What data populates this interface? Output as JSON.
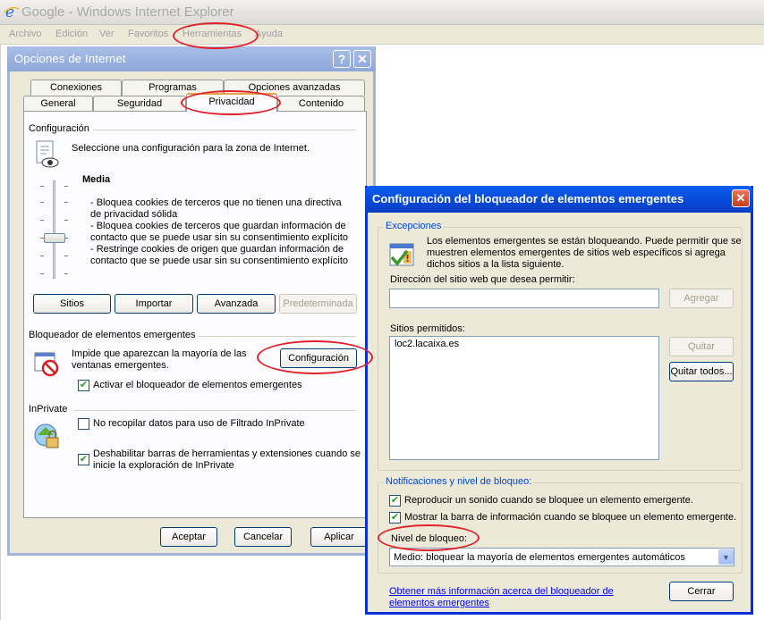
{
  "ie_window": {
    "title": "Google - Windows Internet Explorer",
    "menu": [
      "Archivo",
      "Edición",
      "Ver",
      "Favoritos",
      "Herramientas",
      "Ayuda"
    ]
  },
  "internet_options": {
    "title": "Opciones de Internet",
    "help_glyph": "?",
    "close_glyph": "✕",
    "tabs_back": [
      "Conexiones",
      "Programas",
      "Opciones avanzadas"
    ],
    "tabs_front": [
      "General",
      "Seguridad",
      "Privacidad",
      "Contenido"
    ],
    "active_tab": "Privacidad",
    "config_group": "Configuración",
    "zone_text": "Seleccione una configuración para la zona de Internet.",
    "level_name": "Media",
    "level_description": [
      "- Bloquea cookies de terceros que no tienen una directiva",
      "de privacidad sólida",
      "- Bloquea cookies de terceros que guardan información de",
      "contacto que se puede usar sin su consentimiento explícito",
      "- Restringe cookies de origen que guardan información de",
      "contacto que se  puede usar sin su consentimiento explícito"
    ],
    "buttons": {
      "sites": "Sitios",
      "import": "Importar",
      "advanced": "Avanzada",
      "default": "Predeterminada"
    },
    "popup_group": "Bloqueador de elementos emergentes",
    "popup_text": [
      "Impide que aparezcan la mayoría de las",
      "ventanas emergentes."
    ],
    "popup_settings_button": "Configuración",
    "popup_enable_check": {
      "label": "Activar el bloqueador de elementos emergentes",
      "checked": true
    },
    "inprivate_group": "InPrivate",
    "inprivate_no_collect": {
      "label": "No recopilar datos para uso de Filtrado InPrivate",
      "checked": false
    },
    "inprivate_disable_toolbars": {
      "label": [
        "Deshabilitar barras de herramientas y extensiones cuando se",
        "inicie la exploración de InPrivate"
      ],
      "checked": true
    },
    "footer": {
      "ok": "Aceptar",
      "cancel": "Cancelar",
      "apply": "Aplicar"
    }
  },
  "popup_blocker": {
    "title": "Configuración del bloqueador de elementos emergentes",
    "close_glyph": "✕",
    "exceptions_legend": "Excepciones",
    "exceptions_text": [
      "Los elementos emergentes se están bloqueando. Puede permitir que se",
      "muestren elementos emergentes de sitios web específicos si agrega",
      "dichos sitios a la lista siguiente."
    ],
    "address_label": "Dirección del sitio web que desea permitir:",
    "address_value": "",
    "add_button": "Agregar",
    "allowed_label": "Sitios permitidos:",
    "allowed_sites": [
      "loc2.lacaixa.es"
    ],
    "remove_button": "Quitar",
    "remove_all_button": "Quitar todos...",
    "notifications_legend": "Notificaciones y nivel de bloqueo:",
    "play_sound": {
      "label": "Reproducir un sonido cuando se bloquee un elemento emergente.",
      "checked": true
    },
    "show_info_bar": {
      "label": "Mostrar la barra de información cuando se bloquee un elemento emergente.",
      "checked": true
    },
    "block_level_label": "Nivel de bloqueo:",
    "block_level_value": "Medio: bloquear la mayoría de elementos emergentes automáticos",
    "learn_more_link": [
      "Obtener más información acerca del bloqueador de",
      "elementos emergentes"
    ],
    "close_button": "Cerrar"
  },
  "colors": {
    "annotation_red": "#e0242b",
    "xp_blue": "#0a5fef",
    "dialog_face": "#ece9d8"
  }
}
